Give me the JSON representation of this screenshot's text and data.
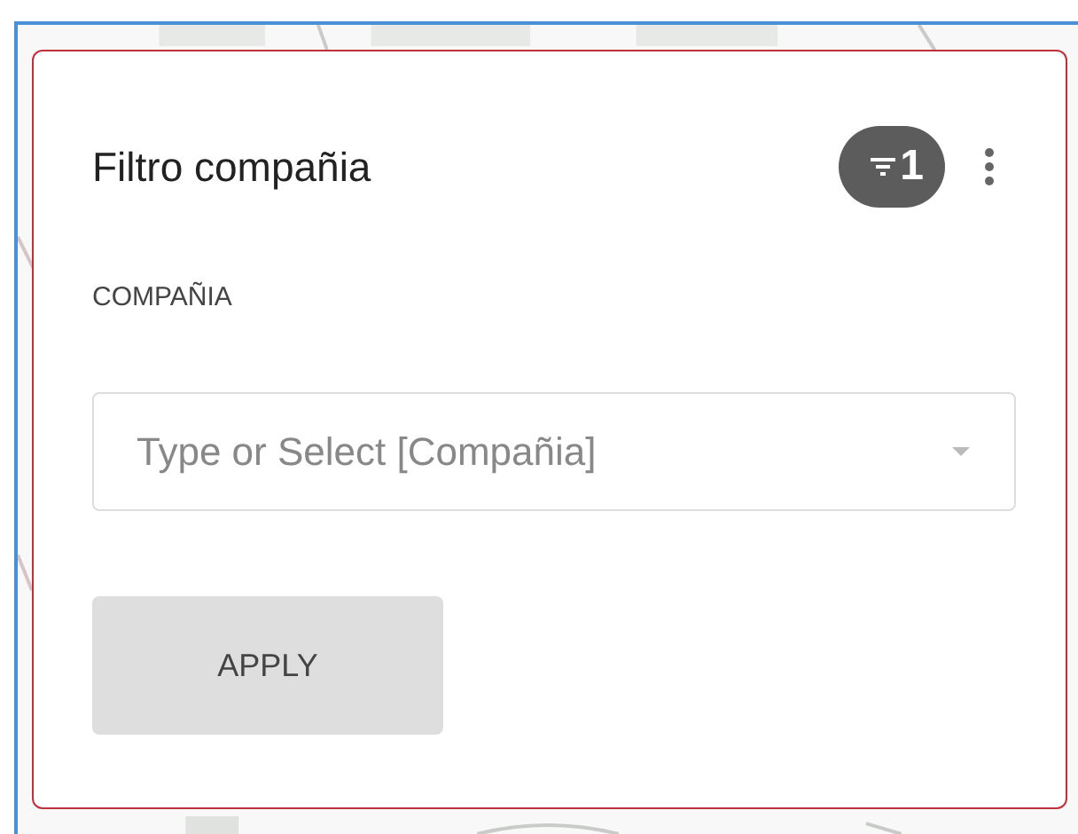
{
  "panel": {
    "title": "Filtro compañia",
    "filter_count": "1"
  },
  "field": {
    "label": "COMPAÑIA",
    "placeholder": "Type or Select [Compañia]"
  },
  "buttons": [
    "APPLY"
  ]
}
